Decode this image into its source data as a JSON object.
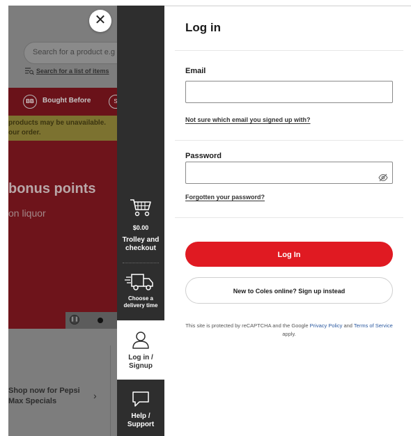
{
  "background": {
    "search_placeholder": "Search for a product e.g",
    "search_list_link": "Search for a list of items",
    "nav_badge": "BB",
    "nav_label": "Bought Before",
    "nav_badge2": "S",
    "warning_line1": "products may be unavailable.",
    "warning_line2": "our order.",
    "hero_heading": "bonus points",
    "hero_sub": "on liquor",
    "promo_line1": "Shop now for Pepsi",
    "promo_line2": "Max Specials"
  },
  "close_label": "✕",
  "sidebar": {
    "trolley_amount": "$0.00",
    "trolley_line1": "Trolley and",
    "trolley_line2": "checkout",
    "delivery_line1": "Choose a",
    "delivery_line2": "delivery time",
    "login_line1": "Log in /",
    "login_line2": "Signup",
    "help_line1": "Help /",
    "help_line2": "Support"
  },
  "login": {
    "title": "Log in",
    "email_label": "Email",
    "email_value": "",
    "email_help_link": "Not sure which email you signed up with?",
    "password_label": "Password",
    "password_value": "",
    "forgot_link": "Forgotten your password?",
    "login_button": "Log In",
    "signup_button": "New to Coles online? Sign up instead",
    "recaptcha_prefix": "This site is protected by reCAPTCHA and the Google",
    "privacy_link": "Privacy Policy",
    "recaptcha_and": "and",
    "terms_link": "Terms of Service",
    "recaptcha_suffix": "apply."
  },
  "colors": {
    "brand_red": "#e01a22",
    "sidebar_bg": "#2e2e2e",
    "link_blue": "#2c5aa0"
  },
  "icons": [
    "close-icon",
    "search-list-icon",
    "trolley-icon",
    "delivery-truck-icon",
    "user-icon",
    "help-chat-icon",
    "eye-slash-icon",
    "pause-icon"
  ]
}
